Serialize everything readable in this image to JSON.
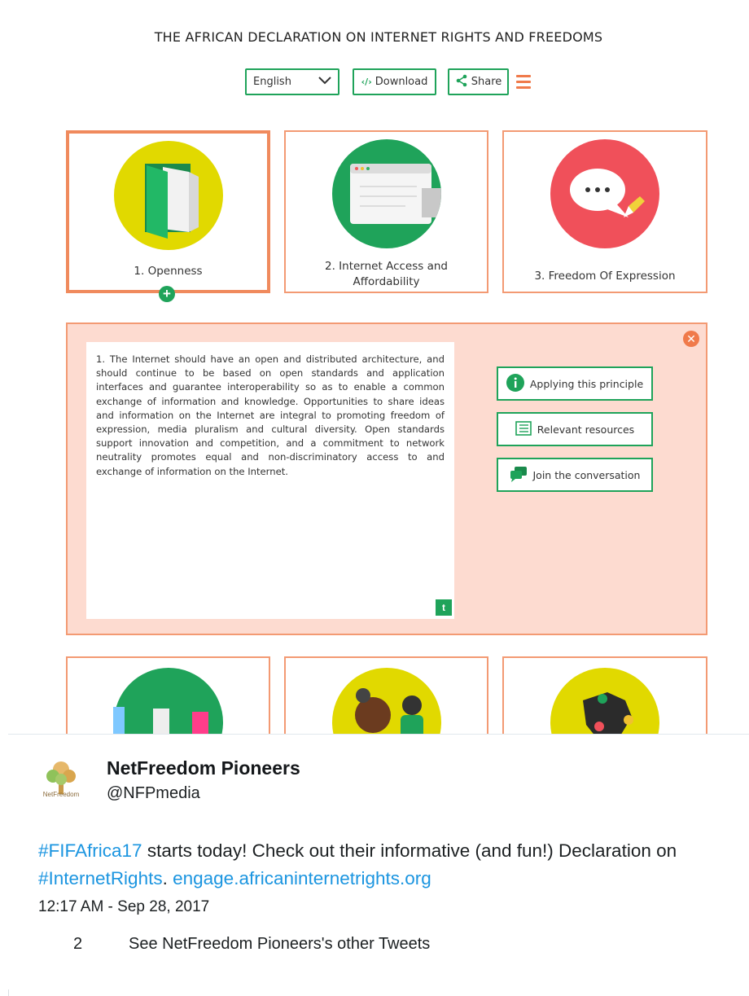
{
  "page": {
    "title": "THE AFRICAN DECLARATION ON INTERNET RIGHTS AND FREEDOMS"
  },
  "toolbar": {
    "language": "English",
    "download_label": "Download",
    "download_icon": "‹/›",
    "share_label": "Share"
  },
  "cards": [
    {
      "label": "1. Openness",
      "color": "#e1d900"
    },
    {
      "label_line1": "2. Internet Access and",
      "label_line2": "Affordability",
      "color": "#1fa35a"
    },
    {
      "label": "3. Freedom Of Expression",
      "color": "#f0505a"
    }
  ],
  "principle": {
    "text": "1. The Internet should have an open and distributed architecture, and should continue to be based on open standards and application interfaces and guarantee interoperability so as to enable a common exchange of information and knowledge. Opportunities to share ideas and information on the Internet are integral to promoting freedom of expression, media pluralism and cultural diversity. Open standards support innovation and competition, and a commitment to network neutrality promotes equal and non-discriminatory access to and exchange of information on the Internet.",
    "actions": {
      "applying": "Applying this principle",
      "resources": "Relevant resources",
      "conversation": "Join the conversation"
    }
  },
  "tweet": {
    "name": "NetFreedom Pioneers",
    "handle": "@NFPmedia",
    "avatar_text": "NetFreedom",
    "hashtag1": "#FIFAfrica17",
    "text1": " starts today! Check out their informative (and fun!) Declaration on ",
    "hashtag2": "#InternetRights",
    "text2": ". ",
    "link": "engage.africaninternetrights.org",
    "timestamp": "12:17 AM - Sep 28, 2017",
    "reply_count": "2",
    "more_tweets": "See NetFreedom Pioneers's other Tweets",
    "link_color": "#1b95e0"
  },
  "colors": {
    "accent_green": "#1fa35a",
    "accent_orange": "#f08a5d",
    "panel_bg": "#fddbd0"
  }
}
